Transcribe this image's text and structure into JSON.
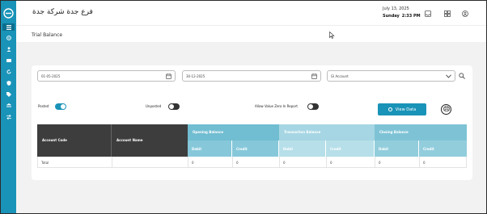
{
  "header": {
    "company_name": "فرع جدة شركة جدة",
    "date": "July 13, 2025",
    "day": "Sunday",
    "time": "2:33 PM",
    "icons": [
      "inbox-icon",
      "grid-icon",
      "user-icon"
    ]
  },
  "page": {
    "title": "Trial Balance"
  },
  "sidebar": {
    "items": [
      "list-icon",
      "gear-icon",
      "users-icon",
      "money-icon",
      "refresh-icon",
      "shield-icon",
      "tag-icon",
      "bank-icon",
      "exchange-icon"
    ]
  },
  "filters": {
    "from_date": "01-05-2025",
    "to_date": "30-12-2025",
    "account_placeholder": "Gl Account"
  },
  "toggles": {
    "posted_label": "Posted",
    "posted_on": true,
    "unposted_label": "Unposted",
    "unposted_on": false,
    "allow_zero_label": "Allow Value Zero In Report",
    "allow_zero_on": false
  },
  "buttons": {
    "view_data": "View Data"
  },
  "table": {
    "col_account_code": "Account Code",
    "col_account_name": "Account Name",
    "groups": {
      "opening": "Opening Balance",
      "transaction": "Transaction Balance",
      "closing": "Closing Balance"
    },
    "debit": "Debit",
    "credit": "Credit",
    "total_row": {
      "label": "Total",
      "opening_debit": "0",
      "opening_credit": "0",
      "transaction_debit": "0",
      "transaction_credit": "0",
      "closing_debit": "0",
      "closing_credit": "0"
    }
  },
  "colors": {
    "primary": "#1a93b8",
    "sidebar_active": "#0c6f8e",
    "table_dark": "#3d3d3d"
  }
}
